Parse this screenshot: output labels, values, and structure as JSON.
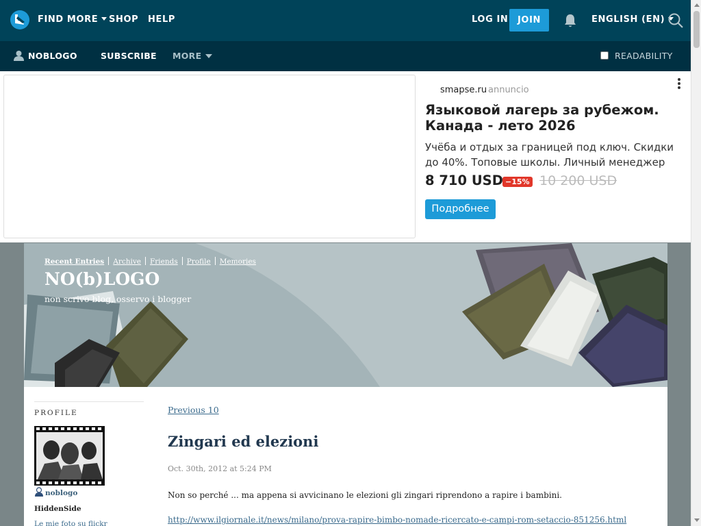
{
  "topnav": {
    "find_more": "FIND MORE",
    "shop": "SHOP",
    "help": "HELP",
    "login": "LOG IN",
    "join": "JOIN",
    "language": "ENGLISH (EN)",
    "brand_color": "#004359",
    "join_color": "#1d9bd8"
  },
  "subnav": {
    "username": "NOBLOGO",
    "subscribe": "SUBSCRIBE",
    "more": "MORE",
    "readability": "READABILITY",
    "readability_checked": false
  },
  "ad": {
    "source": "smapse.ru",
    "tag": "annuncio",
    "title": "Языковой лагерь за рубежом. Канада - лето 2026",
    "text": "Учёба и отдых за границей под ключ. Скидки до 40%. Топовые школы. Личный менеджер",
    "price": "8 710 USD",
    "discount": "−15%",
    "old_price": "10 200 USD",
    "cta": "Подробнее"
  },
  "journal": {
    "nav": [
      "Recent Entries",
      "Archive",
      "Friends",
      "Profile",
      "Memories"
    ],
    "title": "NO(b)LOGO",
    "subtitle": "non scrivo blog, osservo i blogger"
  },
  "sidebar": {
    "heading": "PROFILE",
    "username": "noblogo",
    "name": "HiddenSide",
    "link": "Le mie foto su flickr"
  },
  "content": {
    "prev": "Previous 10",
    "post_title": "Zingari ed elezioni",
    "post_date": "Oct. 30th, 2012 at 5:24 PM",
    "post_body": "Non so perché ... ma appena si avvicinano le elezioni gli zingari riprendono a rapire i bambini.",
    "post_link": "http://www.ilgiornale.it/news/milano/prova-rapire-bimbo-nomade-ricercato-e-campi-rom-setaccio-851256.html"
  }
}
